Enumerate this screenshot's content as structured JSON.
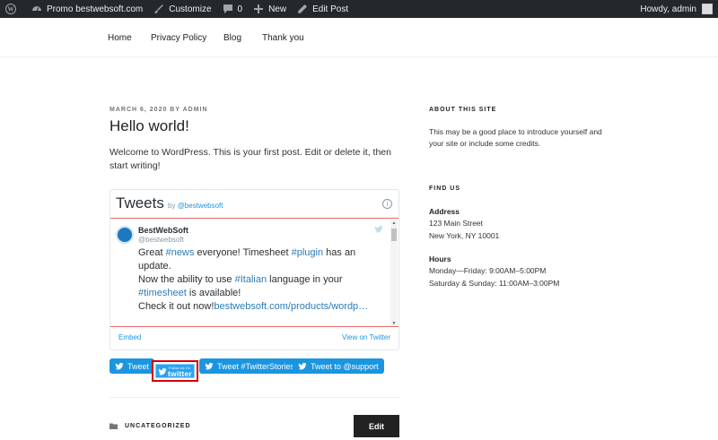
{
  "adminbar": {
    "site_name": "Promo bestwebsoft.com",
    "customize": "Customize",
    "comments_count": "0",
    "new": "New",
    "edit_post": "Edit Post",
    "howdy": "Howdy, admin"
  },
  "nav": {
    "items": [
      "Home",
      "Privacy Policy",
      "Blog",
      "Thank you"
    ]
  },
  "post": {
    "meta": "MARCH 6, 2020 BY ADMIN",
    "title": "Hello world!",
    "text": "Welcome to WordPress. This is your first post. Edit or delete it, then start writing!",
    "category": "UNCATEGORIZED",
    "edit_label": "Edit"
  },
  "timeline": {
    "title": "Tweets",
    "by": "by",
    "handle": "@bestwebsoft",
    "info": "i",
    "tweet": {
      "name": "BestWebSoft",
      "handle": "@bestwebsoft",
      "t1": "Great ",
      "l1": "#news",
      "t2": " everyone! Timesheet ",
      "l2": "#plugin",
      "t3": " has an update.",
      "t4": "Now the ability to use ",
      "l3": "#Italian",
      "t5": " language in your",
      "l4": "#timesheet",
      "t6": " is available!",
      "t7": "Check it out now!",
      "l5": "bestwebsoft.com/products/wordp…"
    },
    "embed": "Embed",
    "view_on_twitter": "View on Twitter"
  },
  "buttons": {
    "tweet": "Tweet",
    "follow_small": "Follow Us On",
    "follow_big": "twitter",
    "tweet_stories": "Tweet #TwitterStories",
    "tweet_support": "Tweet to @support"
  },
  "sidebar": {
    "about_title": "ABOUT THIS SITE",
    "about_text": "This may be a good place to introduce yourself and your site or include some credits.",
    "find_title": "FIND US",
    "address_label": "Address",
    "address_line1": "123 Main Street",
    "address_line2": "New York, NY 10001",
    "hours_label": "Hours",
    "hours_line1": "Monday—Friday: 9:00AM–5:00PM",
    "hours_line2": "Saturday & Sunday: 11:00AM–3:00PM"
  }
}
